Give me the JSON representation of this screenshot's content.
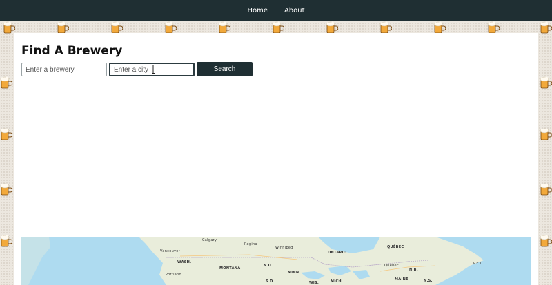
{
  "nav": {
    "links": [
      "Home",
      "About"
    ]
  },
  "page": {
    "title": "Find A Brewery"
  },
  "search": {
    "brewery_placeholder": "Enter a brewery",
    "city_placeholder": "Enter a city",
    "button_label": "Search"
  },
  "map": {
    "labels": {
      "calgary": "Calgary",
      "regina": "Regina",
      "winnipeg": "Winnipeg",
      "quebec": "QUÉBEC",
      "ontario": "ONTARIO",
      "vancouver": "Vancouver",
      "wash": "WASH.",
      "montana": "MONTANA",
      "nd": "N.D.",
      "minn": "MINN",
      "quebec_city": "Québec",
      "nb": "N.B.",
      "pei": "P.E.I.",
      "portland": "Portland",
      "sd": "S.D.",
      "wis": "WIS.",
      "mich": "MICH",
      "maine": "MAINE",
      "ns": "N.S."
    }
  },
  "colors": {
    "navbar": "#1f2f33",
    "button": "#1f2f33",
    "water": "#aedbf0",
    "land": "#e9eddb"
  }
}
